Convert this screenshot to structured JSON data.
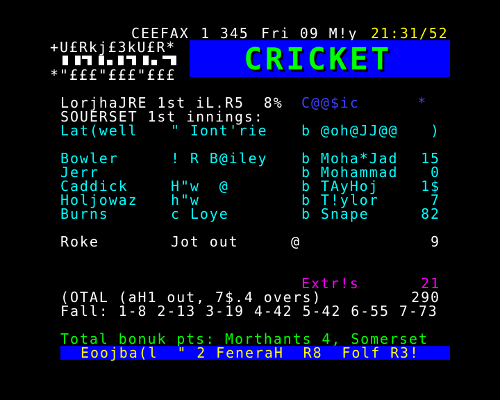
{
  "header": {
    "service": "CEEFAX",
    "page": "1 345",
    "date": "Fri 09 M!y",
    "time": "21:31/52"
  },
  "logo": {
    "top_line": "+U£Rkj£3kU£R*",
    "bottom_line": "*\"£££\"£££\"£££"
  },
  "banner": {
    "title": "CRICKET",
    "text_color": "#00ff00",
    "background": "#0000ff"
  },
  "match": {
    "heading": "LorjhaJRE 1st iL.R5  8%",
    "status": "C@@$ic      *",
    "innings": "SOUERSET 1st innings:"
  },
  "batting": [
    {
      "batsman": "Lat(well",
      "how_out": "\" Iont'rie",
      "bowler": "b @oh@JJ@@",
      "runs": ")"
    },
    {
      "batsman": "Bowler",
      "how_out": "! R B@iley",
      "bowler": "b Moha*Jad",
      "runs": "15"
    },
    {
      "batsman": "Jerr",
      "how_out": "",
      "bowler": "b Mohammad",
      "runs": "0"
    },
    {
      "batsman": "Caddick",
      "how_out": "H\"w  @",
      "bowler": "b TAyHoj",
      "runs": "1$"
    },
    {
      "batsman": "Holjowaz",
      "how_out": "h\"w",
      "bowler": "b T!ylor",
      "runs": "7"
    },
    {
      "batsman": "Burns",
      "how_out": "c Loye",
      "bowler": "b Snape",
      "runs": "82"
    }
  ],
  "not_out": {
    "batsman": "Roke",
    "status": "Jot out",
    "marker": "@",
    "runs": "9"
  },
  "extras": {
    "label": "Extr!s",
    "value": "21"
  },
  "total": {
    "label": "(OTAL (aH1 out, 7$.4 overs)",
    "value": "290"
  },
  "fall": "Fall: 1-8 2-13 3-19 4-42 5-42 6-55 7-73",
  "bonus": "Total bonuk pts: Morthants 4, Somerset",
  "footer": "Eoojba(l  \" 2 FeneraH  R8  Folf R3!"
}
